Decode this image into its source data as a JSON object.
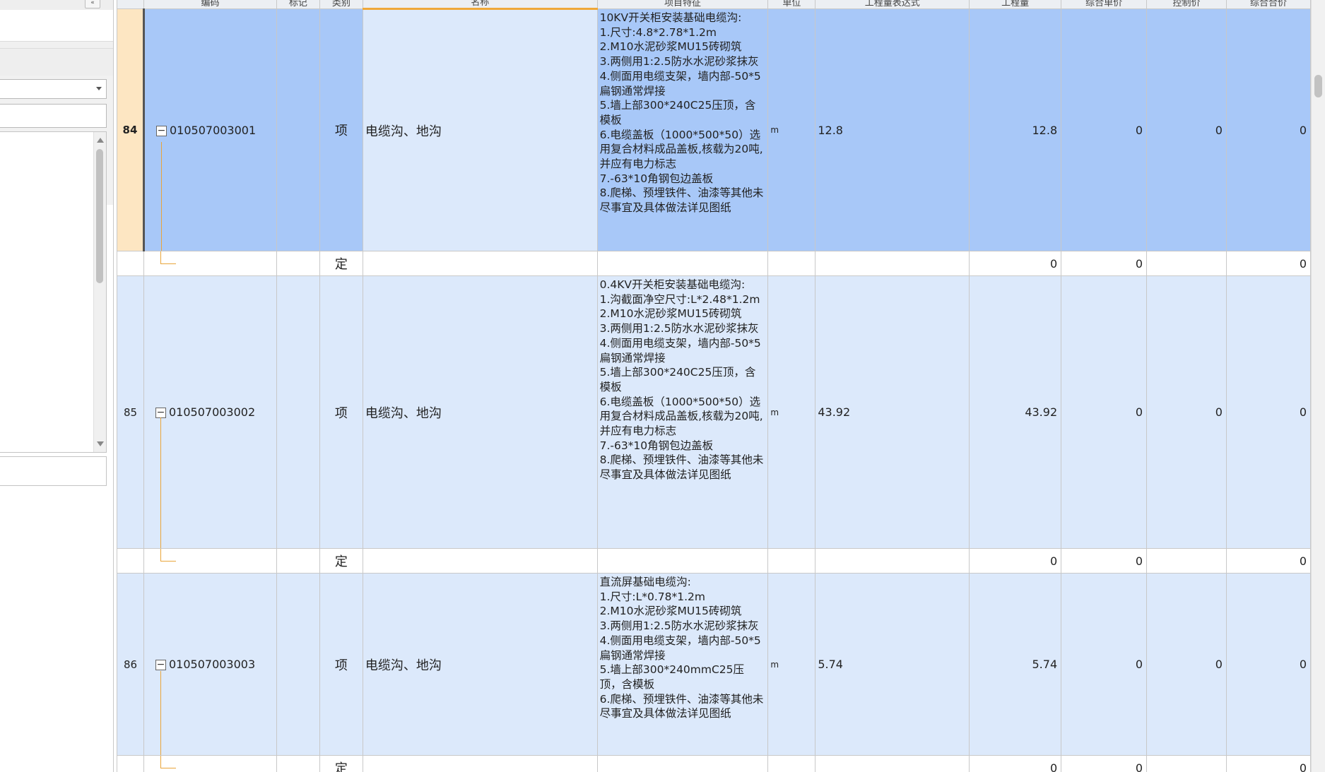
{
  "columns": {
    "code": "编码",
    "flag": "标记",
    "category": "类别",
    "name": "名称",
    "desc": "项目特征",
    "unit": "单位",
    "expr": "工程量表达式",
    "qty": "工程量",
    "unit_price": "综合单价",
    "control_price": "控制价",
    "total": "综合合价"
  },
  "rows": [
    {
      "num": "84",
      "code": "010507003001",
      "category": "项",
      "name": "电缆沟、地沟",
      "desc": "10KV开关柜安装基础电缆沟:\n1.尺寸:4.8*2.78*1.2m\n2.M10水泥砂浆MU15砖砌筑\n3.两侧用1:2.5防水水泥砂浆抹灰\n4.侧面用电缆支架，墙内部-50*5扁钢通常焊接\n5.墙上部300*240C25压顶，含模板\n6.电缆盖板（1000*500*50）选用复合材料成品盖板,核载为20吨,并应有电力标志\n7.-63*10角钢包边盖板\n8.爬梯、预埋铁件、油漆等其他未尽事宜及具体做法详见图纸",
      "unit": "m",
      "expr": "12.8",
      "qty": "12.8",
      "unit_price": "0",
      "control_price": "0",
      "total": "0"
    },
    {
      "category": "定",
      "qty": "0",
      "unit_price": "0",
      "total": "0"
    },
    {
      "num": "85",
      "code": "010507003002",
      "category": "项",
      "name": "电缆沟、地沟",
      "desc": "0.4KV开关柜安装基础电缆沟:\n1.沟截面净空尺寸:L*2.48*1.2m\n2.M10水泥砂浆MU15砖砌筑\n3.两侧用1:2.5防水水泥砂浆抹灰\n4.侧面用电缆支架，墙内部-50*5扁钢通常焊接\n5.墙上部300*240C25压顶，含模板\n6.电缆盖板（1000*500*50）选用复合材料成品盖板,核载为20吨,并应有电力标志\n7.-63*10角钢包边盖板\n8.爬梯、预埋铁件、油漆等其他未尽事宜及具体做法详见图纸",
      "unit": "m",
      "expr": "43.92",
      "qty": "43.92",
      "unit_price": "0",
      "control_price": "0",
      "total": "0"
    },
    {
      "category": "定",
      "qty": "0",
      "unit_price": "0",
      "total": "0"
    },
    {
      "num": "86",
      "code": "010507003003",
      "category": "项",
      "name": "电缆沟、地沟",
      "desc": "直流屏基础电缆沟:\n1.尺寸:L*0.78*1.2m\n2.M10水泥砂浆MU15砖砌筑\n3.两侧用1:2.5防水水泥砂浆抹灰\n4.侧面用电缆支架，墙内部-50*5扁钢通常焊接\n5.墙上部300*240mmC25压顶，含模板\n6.爬梯、预埋铁件、油漆等其他未尽事宜及具体做法详见图纸",
      "unit": "m",
      "expr": "5.74",
      "qty": "5.74",
      "unit_price": "0",
      "control_price": "0",
      "total": "0"
    },
    {
      "category": "定",
      "qty": "0",
      "unit_price": "0",
      "total": "0"
    }
  ],
  "icons": {
    "expand": "−",
    "collapse_panel": "«"
  },
  "colors": {
    "selected_row": "#a8c8f8",
    "item_row": "#dce9fb",
    "row_number_selected": "#fde6c2",
    "tree_line": "#e9a53a"
  }
}
